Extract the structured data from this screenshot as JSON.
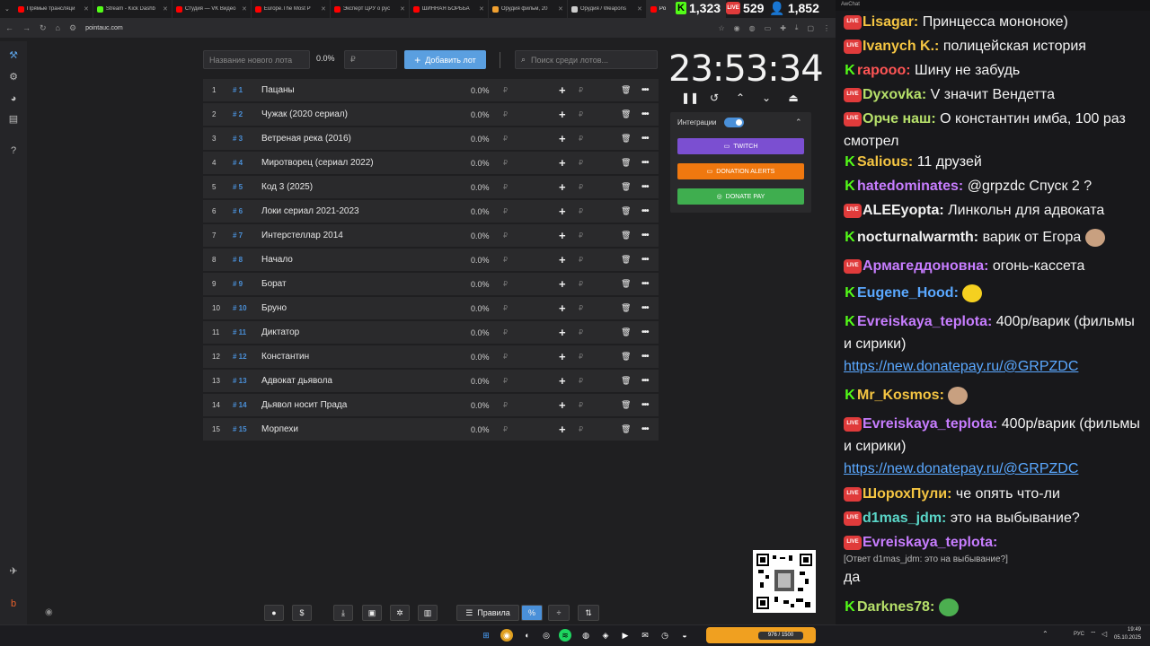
{
  "tabs": [
    {
      "label": "Прямые трансляци",
      "color": "#ff0000"
    },
    {
      "label": "Stream - Kick Dashb",
      "color": "#53fc18"
    },
    {
      "label": "Студия — VK Видео",
      "color": "#ff0000"
    },
    {
      "label": "Europe.The Most P",
      "color": "#ff0000"
    },
    {
      "label": "Эксперт ЦРУ о рус",
      "color": "#ff0000"
    },
    {
      "label": "ШИННАЯ БОРЬБА",
      "color": "#ff0000"
    },
    {
      "label": "Орудия фильм, 20",
      "color": "#f0a030"
    },
    {
      "label": "Орудия / Weapons",
      "color": "#cccccc"
    },
    {
      "label": "Po",
      "color": "#ff0000"
    }
  ],
  "url": "pointauc.com",
  "counters": {
    "kick": "1,323",
    "live": "529",
    "viewers": "1,852"
  },
  "lot_form": {
    "name_placeholder": "Название нового лота",
    "percent": "0.0%",
    "amount_placeholder": "₽",
    "add_label": "Добавить лот",
    "search_placeholder": "Поиск среди лотов..."
  },
  "lots": [
    {
      "num": "1",
      "id": "# 1",
      "name": "Пацаны",
      "pct": "0.0%"
    },
    {
      "num": "2",
      "id": "# 2",
      "name": "Чужак (2020 сериал)",
      "pct": "0.0%"
    },
    {
      "num": "3",
      "id": "# 3",
      "name": "Ветреная река (2016)",
      "pct": "0.0%"
    },
    {
      "num": "4",
      "id": "# 4",
      "name": "Миротворец (сериал 2022)",
      "pct": "0.0%"
    },
    {
      "num": "5",
      "id": "# 5",
      "name": "Код 3 (2025)",
      "pct": "0.0%"
    },
    {
      "num": "6",
      "id": "# 6",
      "name": "Локи сериал 2021-2023",
      "pct": "0.0%"
    },
    {
      "num": "7",
      "id": "# 7",
      "name": "Интерстеллар 2014",
      "pct": "0.0%"
    },
    {
      "num": "8",
      "id": "# 8",
      "name": "Начало",
      "pct": "0.0%"
    },
    {
      "num": "9",
      "id": "# 9",
      "name": "Борат",
      "pct": "0.0%"
    },
    {
      "num": "10",
      "id": "# 10",
      "name": "Бруно",
      "pct": "0.0%"
    },
    {
      "num": "11",
      "id": "# 11",
      "name": "Диктатор",
      "pct": "0.0%"
    },
    {
      "num": "12",
      "id": "# 12",
      "name": "Константин",
      "pct": "0.0%"
    },
    {
      "num": "13",
      "id": "# 13",
      "name": "Адвокат дьявола",
      "pct": "0.0%"
    },
    {
      "num": "14",
      "id": "# 14",
      "name": "Дьявол носит Прада",
      "pct": "0.0%"
    },
    {
      "num": "15",
      "id": "# 15",
      "name": "Морпехи",
      "pct": "0.0%"
    }
  ],
  "currency": "₽",
  "timer": "23:53:34",
  "integrations": {
    "label": "Интеграции",
    "twitch": "TWITCH",
    "donation_alerts": "DONATION ALERTS",
    "donate_pay": "DONATE PAY"
  },
  "toolbar": {
    "rules": "Правила"
  },
  "chat": {
    "title": "AwChat",
    "messages": [
      {
        "src": "live",
        "user": "Lisagar:",
        "color": "#f5c542",
        "text": "Принцесса мононоке)"
      },
      {
        "src": "live",
        "user": "Ivanych K.:",
        "color": "#f5c542",
        "text": "полицейская история"
      },
      {
        "src": "kick",
        "user": "rapooo:",
        "color": "#ff5555",
        "text": "Шину не забудь"
      },
      {
        "src": "live",
        "user": "Dyxovka:",
        "color": "#b6e06a",
        "text": "V значит Вендетта"
      },
      {
        "src": "live",
        "user": "Орче наш:",
        "color": "#b6e06a",
        "text": "О константин имба, 100 раз смотрел"
      },
      {
        "src": "kick",
        "user": "Salious:",
        "color": "#f5c542",
        "text": "11 друзей"
      },
      {
        "src": "kick",
        "user": "hatedominates:",
        "color": "#c77dff",
        "text": "@grpzdc Спуск 2 ?"
      },
      {
        "src": "live",
        "user": "ALEEyopta:",
        "color": "#f2f2f2",
        "text": "Линкольн для адвоката"
      },
      {
        "src": "kick",
        "user": "nocturnalwarmth:",
        "color": "#f2f2f2",
        "text": "варик от Егора"
      },
      {
        "src": "live",
        "user": "Армагеддоновна:",
        "color": "#c77dff",
        "text": "огонь-кассета"
      },
      {
        "src": "kick",
        "user": "Eugene_Hood:",
        "color": "#5aa8ff",
        "text": ""
      },
      {
        "src": "kick",
        "user": "Evreiskaya_teplota:",
        "color": "#c77dff",
        "text": "400р/варик (фильмы и сирики)",
        "link": "https://new.donatepay.ru/@GRPZDC"
      },
      {
        "src": "kick",
        "user": "Mr_Kosmos:",
        "color": "#f5c542",
        "text": ""
      },
      {
        "src": "live",
        "user": "Evreiskaya_teplota:",
        "color": "#c77dff",
        "text": "400р/варик (фильмы и сирики)",
        "link": "https://new.donatepay.ru/@GRPZDC"
      },
      {
        "src": "live",
        "user": "ШорохПули:",
        "color": "#f5c542",
        "text": "че опять что-ли"
      },
      {
        "src": "live",
        "user": "d1mas_jdm:",
        "color": "#5ad6c8",
        "text": "это на выбывание?"
      },
      {
        "src": "live",
        "user": "Evreiskaya_teplota:",
        "color": "#c77dff",
        "text": "",
        "reply": "[Ответ d1mas_jdm: это на выбывание?]",
        "after": "да"
      },
      {
        "src": "kick",
        "user": "Darknes78:",
        "color": "#b6e06a",
        "text": ""
      }
    ]
  },
  "taskbar": {
    "lang": "РУС",
    "time": "19:49",
    "date": "05.10.2025",
    "widget": "976 / 1500"
  }
}
